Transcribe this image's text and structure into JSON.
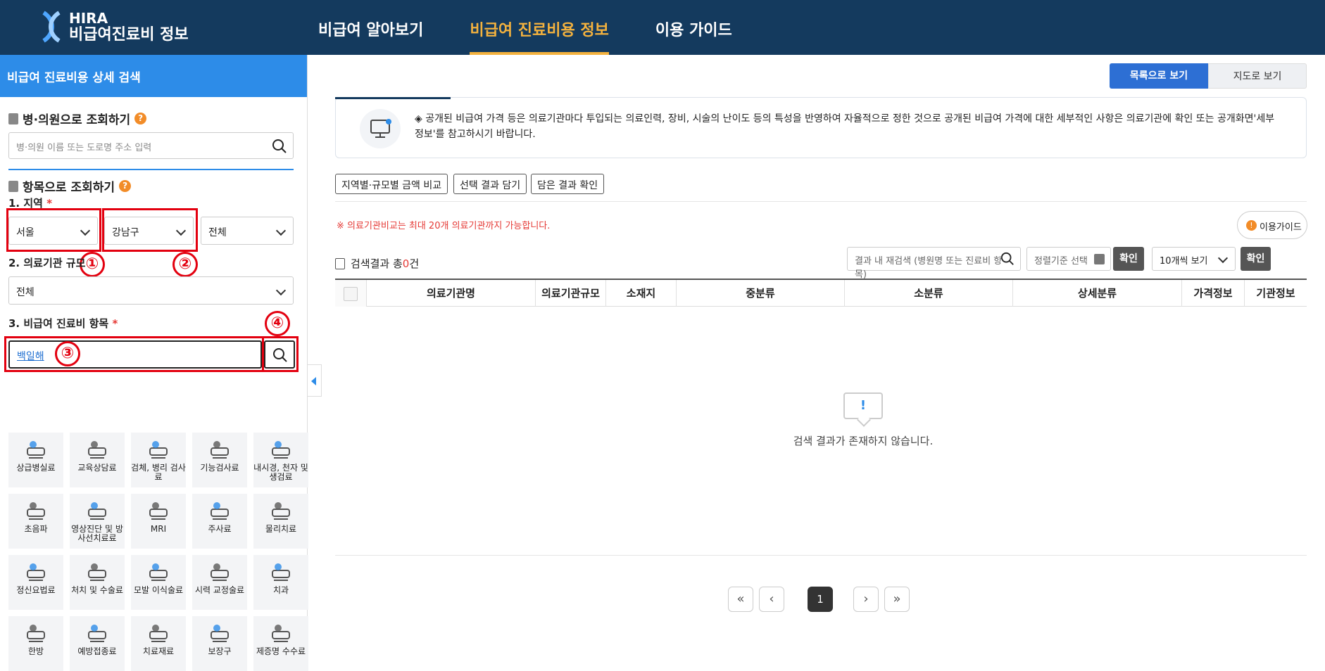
{
  "header": {
    "logo_line1": "HIRA",
    "logo_line2": "비급여진료비 정보",
    "nav": [
      "비급여 알아보기",
      "비급여 진료비용 정보",
      "이용 가이드"
    ],
    "active_nav": "비급여 진료비용 정보",
    "bg_color": "#143a5e",
    "accent_color": "#f4b23e"
  },
  "sidebar": {
    "title": "비급여 진료비용 상세 검색",
    "hospital_search": {
      "heading": "병·의원으로 조회하기",
      "help_icon": "?",
      "placeholder": "병·의원 이름 또는 도로명 주소 입력"
    },
    "item_search": {
      "heading": "항목으로 조회하기",
      "help_icon": "?",
      "region_label": "1. 지역",
      "required_mark": "*",
      "region_values": [
        "서울",
        "강남구",
        "전체"
      ],
      "scale_label": "2. 의료기관 규모",
      "scale_value": "전체",
      "item_label": "3. 비급여 진료비 항목",
      "item_value": "백일해"
    },
    "annotations": [
      "①",
      "②",
      "③",
      "④"
    ],
    "categories": [
      {
        "label": "상급병실료",
        "icon": "hospital-bed-icon"
      },
      {
        "label": "교육상담료",
        "icon": "counseling-icon"
      },
      {
        "label": "검체, 병리 검사료",
        "icon": "microscope-icon"
      },
      {
        "label": "기능검사료",
        "icon": "function-test-icon"
      },
      {
        "label": "내시경, 천자 및 생검료",
        "icon": "endoscope-icon"
      },
      {
        "label": "초음파",
        "icon": "ultrasound-icon"
      },
      {
        "label": "영상진단 및 방사선치료료",
        "icon": "radiology-icon"
      },
      {
        "label": "MRI",
        "icon": "mri-icon"
      },
      {
        "label": "주사료",
        "icon": "syringe-icon"
      },
      {
        "label": "물리치료",
        "icon": "physical-therapy-icon"
      },
      {
        "label": "정신요법료",
        "icon": "brain-icon"
      },
      {
        "label": "처치 및 수술료",
        "icon": "scalpel-icon"
      },
      {
        "label": "모발 이식술료",
        "icon": "hair-icon"
      },
      {
        "label": "시력 교정술료",
        "icon": "eye-icon"
      },
      {
        "label": "치과",
        "icon": "tooth-icon"
      },
      {
        "label": "한방",
        "icon": "ear-acupuncture-icon"
      },
      {
        "label": "예방접종료",
        "icon": "vaccine-icon"
      },
      {
        "label": "치료재료",
        "icon": "lens-icon"
      },
      {
        "label": "보장구",
        "icon": "wheelchair-icon"
      },
      {
        "label": "제증명 수수료",
        "icon": "certificate-icon"
      }
    ]
  },
  "main": {
    "view_buttons": [
      "목록으로 보기",
      "지도로 보기"
    ],
    "notice": "◈ 공개된 비급여 가격 등은 의료기관마다 투입되는 의료인력, 장비, 시술의 난이도 등의 특성을 반영하여 자율적으로 정한 것으로 공개된 비급여 가격에 대한 세부적인 사항은 의료기관에 확인 또는 공개화면'세부정보'를 참고하시기 바랍니다.",
    "tool_buttons": [
      "지역별·규모별 금액 비교",
      "선택 결과 담기",
      "담은 결과 확인"
    ],
    "warning": "※ 의료기관비교는 최대 20개 의료기관까지 가능합니다.",
    "guide_button": "이용가이드",
    "result_prefix": "검색결과 총",
    "result_count": "0",
    "result_suffix": "건",
    "research_placeholder": "결과 내 재검색 (병원명 또는 진료비 항목)",
    "sort_label": "정렬기준 선택",
    "confirm": "확인",
    "per_page": "10개씩 보기",
    "columns": [
      "의료기관명",
      "의료기관규모",
      "소재지",
      "중분류",
      "소분류",
      "상세분류",
      "가격정보",
      "기관정보"
    ],
    "empty_mark": "!",
    "empty_text": "검색 결과가 존재하지 않습니다.",
    "pagination": {
      "first": "«",
      "prev": "‹",
      "current": "1",
      "next": "›",
      "last": "»"
    }
  }
}
